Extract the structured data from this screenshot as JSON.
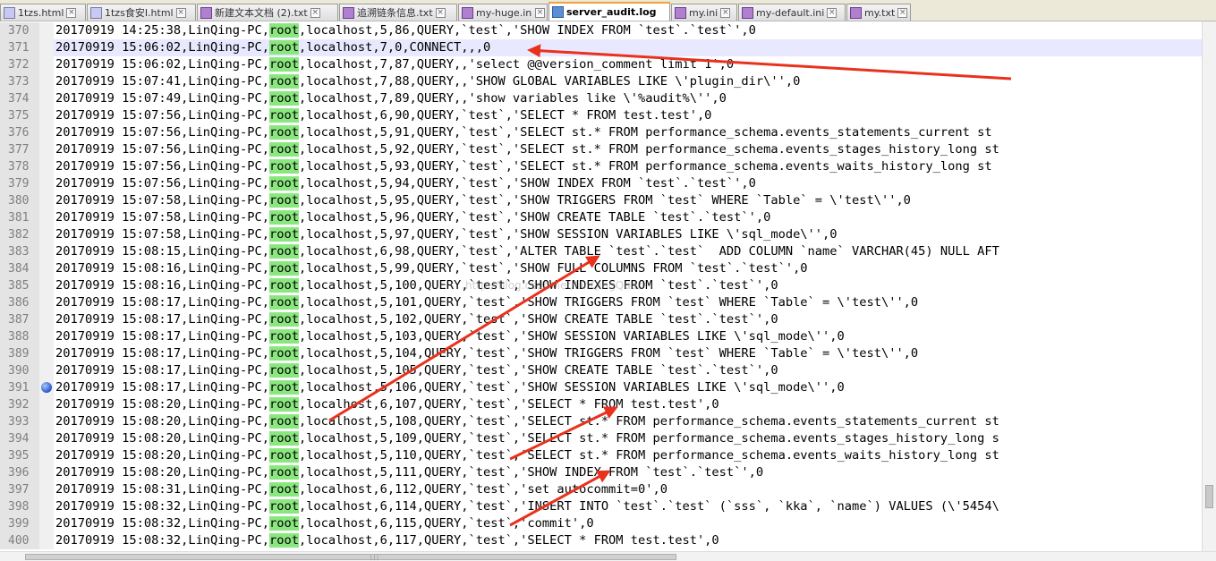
{
  "tabs": [
    {
      "label": "1tzs.html",
      "icon": "html-file-icon",
      "active": false,
      "closable": true
    },
    {
      "label": "1tzs食安I.html",
      "icon": "html-file-icon",
      "active": false,
      "closable": true
    },
    {
      "label": "新建文本文档 (2).txt",
      "icon": "disk-file-icon",
      "active": false,
      "closable": true
    },
    {
      "label": "追溯链条信息.txt",
      "icon": "disk-file-icon",
      "active": false,
      "closable": true
    },
    {
      "label": "my-huge.ini",
      "icon": "disk-file-icon",
      "active": false,
      "closable": true
    },
    {
      "label": "server_audit.log",
      "icon": "saved-file-icon",
      "active": true,
      "closable": true
    },
    {
      "label": "my.ini",
      "icon": "disk-file-icon",
      "active": false,
      "closable": true
    },
    {
      "label": "my-default.ini",
      "icon": "disk-file-icon",
      "active": false,
      "closable": true
    },
    {
      "label": "my.txt",
      "icon": "disk-file-icon",
      "active": false,
      "closable": true
    }
  ],
  "editor": {
    "highlight_word": "root",
    "current_line": "371",
    "bookmark_line": "391",
    "lines": [
      {
        "num": "370",
        "pre": "20170919 14:25:38,LinQing-PC,",
        "post": ",localhost,5,86,QUERY,`test`,'SHOW INDEX FROM `test`.`test`',0"
      },
      {
        "num": "371",
        "pre": "20170919 15:06:02,LinQing-PC,",
        "post": ",localhost,7,0,CONNECT,,,0"
      },
      {
        "num": "372",
        "pre": "20170919 15:06:02,LinQing-PC,",
        "post": ",localhost,7,87,QUERY,,'select @@version_comment limit 1',0"
      },
      {
        "num": "373",
        "pre": "20170919 15:07:41,LinQing-PC,",
        "post": ",localhost,7,88,QUERY,,'SHOW GLOBAL VARIABLES LIKE \\'plugin_dir\\'',0"
      },
      {
        "num": "374",
        "pre": "20170919 15:07:49,LinQing-PC,",
        "post": ",localhost,7,89,QUERY,,'show variables like \\'%audit%\\'',0"
      },
      {
        "num": "375",
        "pre": "20170919 15:07:56,LinQing-PC,",
        "post": ",localhost,6,90,QUERY,`test`,'SELECT * FROM test.test',0"
      },
      {
        "num": "376",
        "pre": "20170919 15:07:56,LinQing-PC,",
        "post": ",localhost,5,91,QUERY,`test`,'SELECT st.* FROM performance_schema.events_statements_current st"
      },
      {
        "num": "377",
        "pre": "20170919 15:07:56,LinQing-PC,",
        "post": ",localhost,5,92,QUERY,`test`,'SELECT st.* FROM performance_schema.events_stages_history_long st"
      },
      {
        "num": "378",
        "pre": "20170919 15:07:56,LinQing-PC,",
        "post": ",localhost,5,93,QUERY,`test`,'SELECT st.* FROM performance_schema.events_waits_history_long st"
      },
      {
        "num": "379",
        "pre": "20170919 15:07:56,LinQing-PC,",
        "post": ",localhost,5,94,QUERY,`test`,'SHOW INDEX FROM `test`.`test`',0"
      },
      {
        "num": "380",
        "pre": "20170919 15:07:58,LinQing-PC,",
        "post": ",localhost,5,95,QUERY,`test`,'SHOW TRIGGERS FROM `test` WHERE `Table` = \\'test\\'',0"
      },
      {
        "num": "381",
        "pre": "20170919 15:07:58,LinQing-PC,",
        "post": ",localhost,5,96,QUERY,`test`,'SHOW CREATE TABLE `test`.`test`',0"
      },
      {
        "num": "382",
        "pre": "20170919 15:07:58,LinQing-PC,",
        "post": ",localhost,5,97,QUERY,`test`,'SHOW SESSION VARIABLES LIKE \\'sql_mode\\'',0"
      },
      {
        "num": "383",
        "pre": "20170919 15:08:15,LinQing-PC,",
        "post": ",localhost,6,98,QUERY,`test`,'ALTER TABLE `test`.`test`  ADD COLUMN `name` VARCHAR(45) NULL AFT"
      },
      {
        "num": "384",
        "pre": "20170919 15:08:16,LinQing-PC,",
        "post": ",localhost,5,99,QUERY,`test`,'SHOW FULL COLUMNS FROM `test`.`test`',0"
      },
      {
        "num": "385",
        "pre": "20170919 15:08:16,LinQing-PC,",
        "post": ",localhost,5,100,QUERY,`test`,'SHOW INDEXES FROM `test`.`test`',0"
      },
      {
        "num": "386",
        "pre": "20170919 15:08:17,LinQing-PC,",
        "post": ",localhost,5,101,QUERY,`test`,'SHOW TRIGGERS FROM `test` WHERE `Table` = \\'test\\'',0"
      },
      {
        "num": "387",
        "pre": "20170919 15:08:17,LinQing-PC,",
        "post": ",localhost,5,102,QUERY,`test`,'SHOW CREATE TABLE `test`.`test`',0"
      },
      {
        "num": "388",
        "pre": "20170919 15:08:17,LinQing-PC,",
        "post": ",localhost,5,103,QUERY,`test`,'SHOW SESSION VARIABLES LIKE \\'sql_mode\\'',0"
      },
      {
        "num": "389",
        "pre": "20170919 15:08:17,LinQing-PC,",
        "post": ",localhost,5,104,QUERY,`test`,'SHOW TRIGGERS FROM `test` WHERE `Table` = \\'test\\'',0"
      },
      {
        "num": "390",
        "pre": "20170919 15:08:17,LinQing-PC,",
        "post": ",localhost,5,105,QUERY,`test`,'SHOW CREATE TABLE `test`.`test`',0"
      },
      {
        "num": "391",
        "pre": "20170919 15:08:17,LinQing-PC,",
        "post": ",localhost,5,106,QUERY,`test`,'SHOW SESSION VARIABLES LIKE \\'sql_mode\\'',0"
      },
      {
        "num": "392",
        "pre": "20170919 15:08:20,LinQing-PC,",
        "post": ",localhost,6,107,QUERY,`test`,'SELECT * FROM test.test',0"
      },
      {
        "num": "393",
        "pre": "20170919 15:08:20,LinQing-PC,",
        "post": ",localhost,5,108,QUERY,`test`,'SELECT st.* FROM performance_schema.events_statements_current st"
      },
      {
        "num": "394",
        "pre": "20170919 15:08:20,LinQing-PC,",
        "post": ",localhost,5,109,QUERY,`test`,'SELECT st.* FROM performance_schema.events_stages_history_long s"
      },
      {
        "num": "395",
        "pre": "20170919 15:08:20,LinQing-PC,",
        "post": ",localhost,5,110,QUERY,`test`,'SELECT st.* FROM performance_schema.events_waits_history_long st"
      },
      {
        "num": "396",
        "pre": "20170919 15:08:20,LinQing-PC,",
        "post": ",localhost,5,111,QUERY,`test`,'SHOW INDEX FROM `test`.`test`',0"
      },
      {
        "num": "397",
        "pre": "20170919 15:08:31,LinQing-PC,",
        "post": ",localhost,6,112,QUERY,`test`,'set autocommit=0',0"
      },
      {
        "num": "398",
        "pre": "20170919 15:08:32,LinQing-PC,",
        "post": ",localhost,6,114,QUERY,`test`,'INSERT INTO `test`.`test` (`sss`, `kka`, `name`) VALUES (\\'5454\\"
      },
      {
        "num": "399",
        "pre": "20170919 15:08:32,LinQing-PC,",
        "post": ",localhost,6,115,QUERY,`test`,'commit',0"
      },
      {
        "num": "400",
        "pre": "20170919 15:08:32,LinQing-PC,",
        "post": ",localhost,6,117,QUERY,`test`,'SELECT * FROM test.test',0"
      }
    ]
  },
  "watermark": "http://blog.csdn.net/LinQingQuan",
  "colors": {
    "highlight": "#8ae77f",
    "current_line": "#e8e8ff",
    "arrow": "#e8321e",
    "active_tab_accent": "#f2a23a"
  }
}
